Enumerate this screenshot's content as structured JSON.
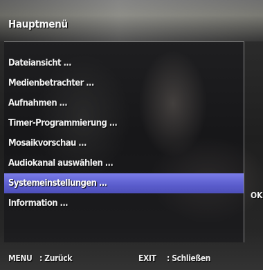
{
  "header": {
    "title": "Hauptmenü"
  },
  "menu": {
    "items": [
      {
        "label": "Dateiansicht ..."
      },
      {
        "label": "Medienbetrachter ..."
      },
      {
        "label": "Aufnahmen ..."
      },
      {
        "label": "Timer-Programmierung ..."
      },
      {
        "label": "Mosaikvorschau ..."
      },
      {
        "label": "Audiokanal auswählen ..."
      },
      {
        "label": "Systemeinstellungen ..."
      },
      {
        "label": "Information ..."
      }
    ],
    "selected_index": 6,
    "ok_label": "OK"
  },
  "footer": {
    "menu_key": "MENU",
    "menu_action": ": Zurück",
    "exit_key": "EXIT",
    "exit_action": ": Schließen"
  },
  "colors": {
    "selection": "#5a5ccc"
  }
}
